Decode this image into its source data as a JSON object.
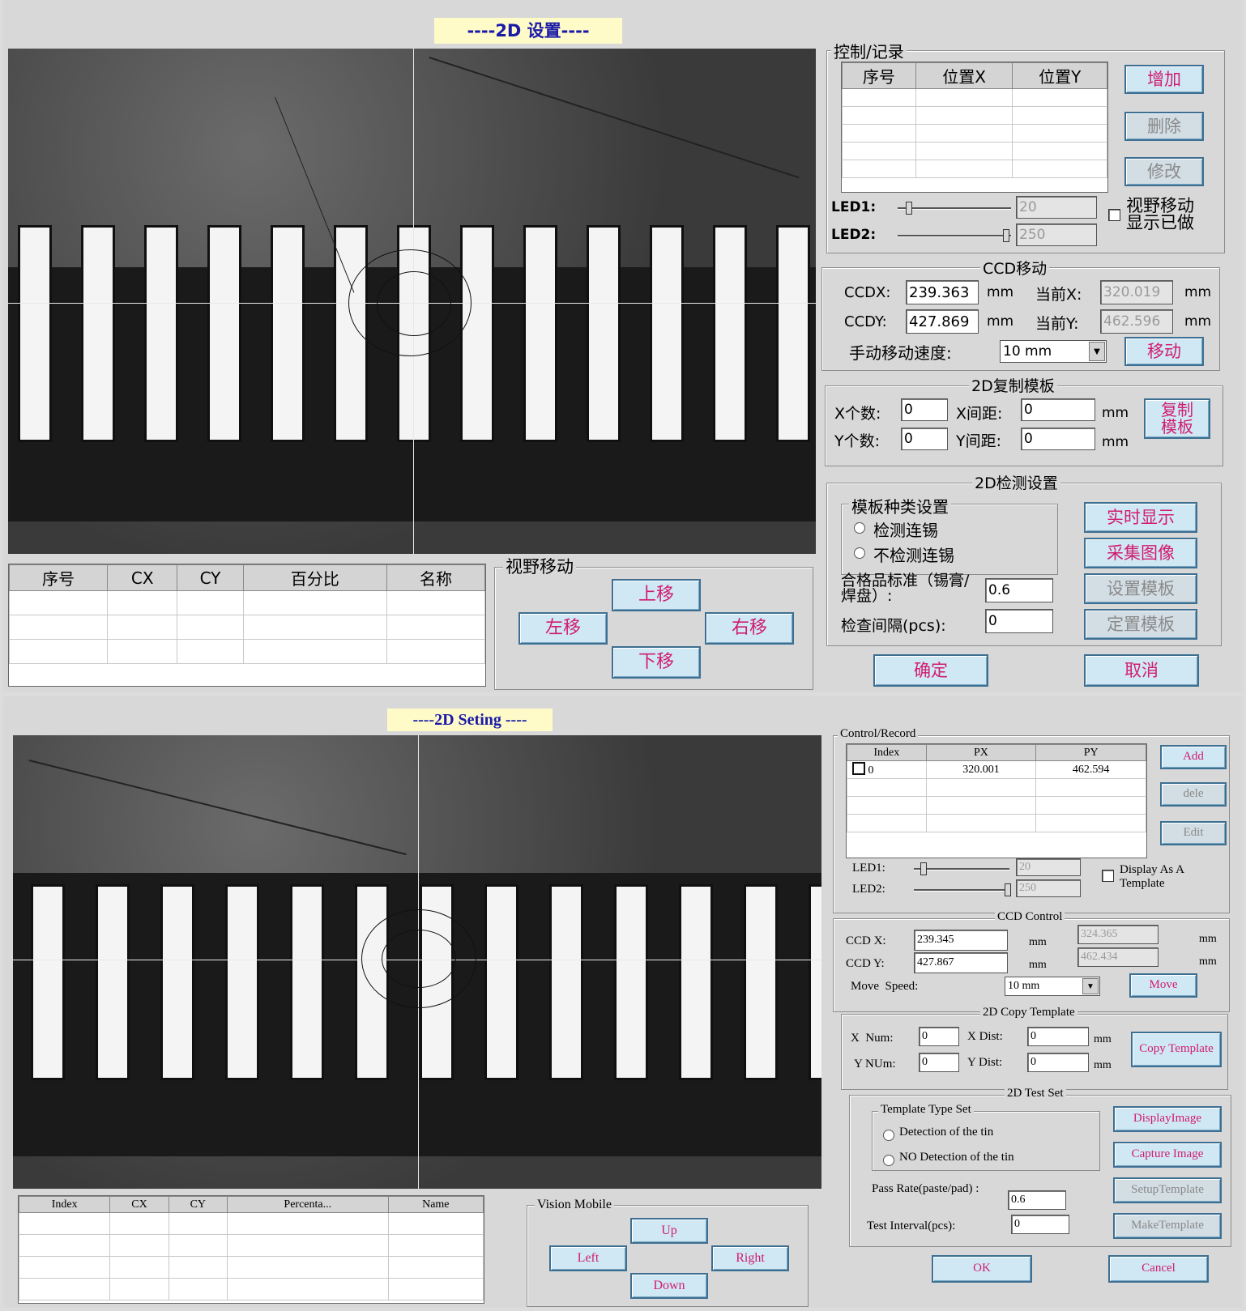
{
  "cn": {
    "title": "----2D 设置----",
    "record": {
      "group_label": "控制/记录",
      "columns": [
        "序号",
        "位置X",
        "位置Y"
      ],
      "add": "增加",
      "delete": "删除",
      "modify": "修改"
    },
    "led": {
      "led1_label": "LED1:",
      "led1_value": "20",
      "led2_label": "LED2:",
      "led2_value": "250"
    },
    "view_move_display": "视野移动显示已做",
    "ccd": {
      "group_label": "CCD移动",
      "x_label": "CCDX:",
      "x_value": "239.363",
      "y_label": "CCDY:",
      "y_value": "427.869",
      "mm": "mm",
      "cur_x_label": "当前X:",
      "cur_x_value": "320.019",
      "cur_y_label": "当前Y:",
      "cur_y_value": "462.596",
      "speed_label": "手动移动速度:",
      "speed_value": "10 mm",
      "move": "移动"
    },
    "copy": {
      "group_label": "2D复制模板",
      "xnum_label": "X个数:",
      "xnum": "0",
      "ynum_label": "Y个数:",
      "ynum": "0",
      "xdist_label": "X间距:",
      "xdist": "0",
      "ydist_label": "Y间距:",
      "ydist": "0",
      "mm": "mm",
      "button": "复制模板"
    },
    "test": {
      "group_label": "2D检测设置",
      "type_label": "模板种类设置",
      "opt1": "检测连锡",
      "opt2": "不检测连锡",
      "pass_label": "合格品标准（锡膏/焊盘）:",
      "pass_value": "0.6",
      "interval_label": "检查间隔(pcs):",
      "interval_value": "0",
      "display": "实时显示",
      "capture": "采集图像",
      "setup": "设置模板",
      "make": "定置模板"
    },
    "result_columns": [
      "序号",
      "CX",
      "CY",
      "百分比",
      "名称"
    ],
    "vision": {
      "group_label": "视野移动",
      "up": "上移",
      "left": "左移",
      "right": "右移",
      "down": "下移"
    },
    "ok": "确定",
    "cancel": "取消"
  },
  "en": {
    "title": "----2D Seting ----",
    "record": {
      "group_label": "Control/Record",
      "columns": [
        "Index",
        "PX",
        "PY"
      ],
      "rows": [
        {
          "index": "0",
          "px": "320.001",
          "py": "462.594"
        }
      ],
      "add": "Add",
      "delete": "dele",
      "modify": "Edit"
    },
    "led": {
      "led1_label": "LED1:",
      "led1_value": "20",
      "led2_label": "LED2:",
      "led2_value": "250"
    },
    "view_move_display": "Display As A Template",
    "ccd": {
      "group_label": "CCD Control",
      "x_label": "CCD X:",
      "x_value": "239.345",
      "y_label": "CCD Y:",
      "y_value": "427.867",
      "mm": "mm",
      "cur_x_value": "324.365",
      "cur_y_value": "462.434",
      "speed_label": "Move  Speed:",
      "speed_value": "10 mm",
      "move": "Move"
    },
    "copy": {
      "group_label": "2D Copy Template",
      "xnum_label": "X  Num:",
      "xnum": "0",
      "ynum_label": "Y NUm:",
      "ynum": "0",
      "xdist_label": "X Dist:",
      "xdist": "0",
      "ydist_label": "Y Dist:",
      "ydist": "0",
      "mm": "mm",
      "button": "Copy Template"
    },
    "test": {
      "group_label": "2D Test Set",
      "type_label": "Template Type Set",
      "opt1": "Detection of the tin",
      "opt2": "NO Detection of the tin",
      "pass_label": "Pass Rate(paste/pad) :",
      "pass_value": "0.6",
      "interval_label": "Test Interval(pcs):",
      "interval_value": "0",
      "display": "DisplayImage",
      "capture": "Capture Image",
      "setup": "SetupTemplate",
      "make": "MakeTemplate"
    },
    "result_columns": [
      "Index",
      "CX",
      "CY",
      "Percenta...",
      "Name"
    ],
    "vision": {
      "group_label": "Vision Mobile",
      "up": "Up",
      "left": "Left",
      "right": "Right",
      "down": "Down"
    },
    "ok": "OK",
    "cancel": "Cancel"
  },
  "colors": {
    "title_bg": "#fffbc8",
    "title_text": "#1a1aa8",
    "button_text": "#d21c6e",
    "button_bg": "#cfe8f4"
  }
}
